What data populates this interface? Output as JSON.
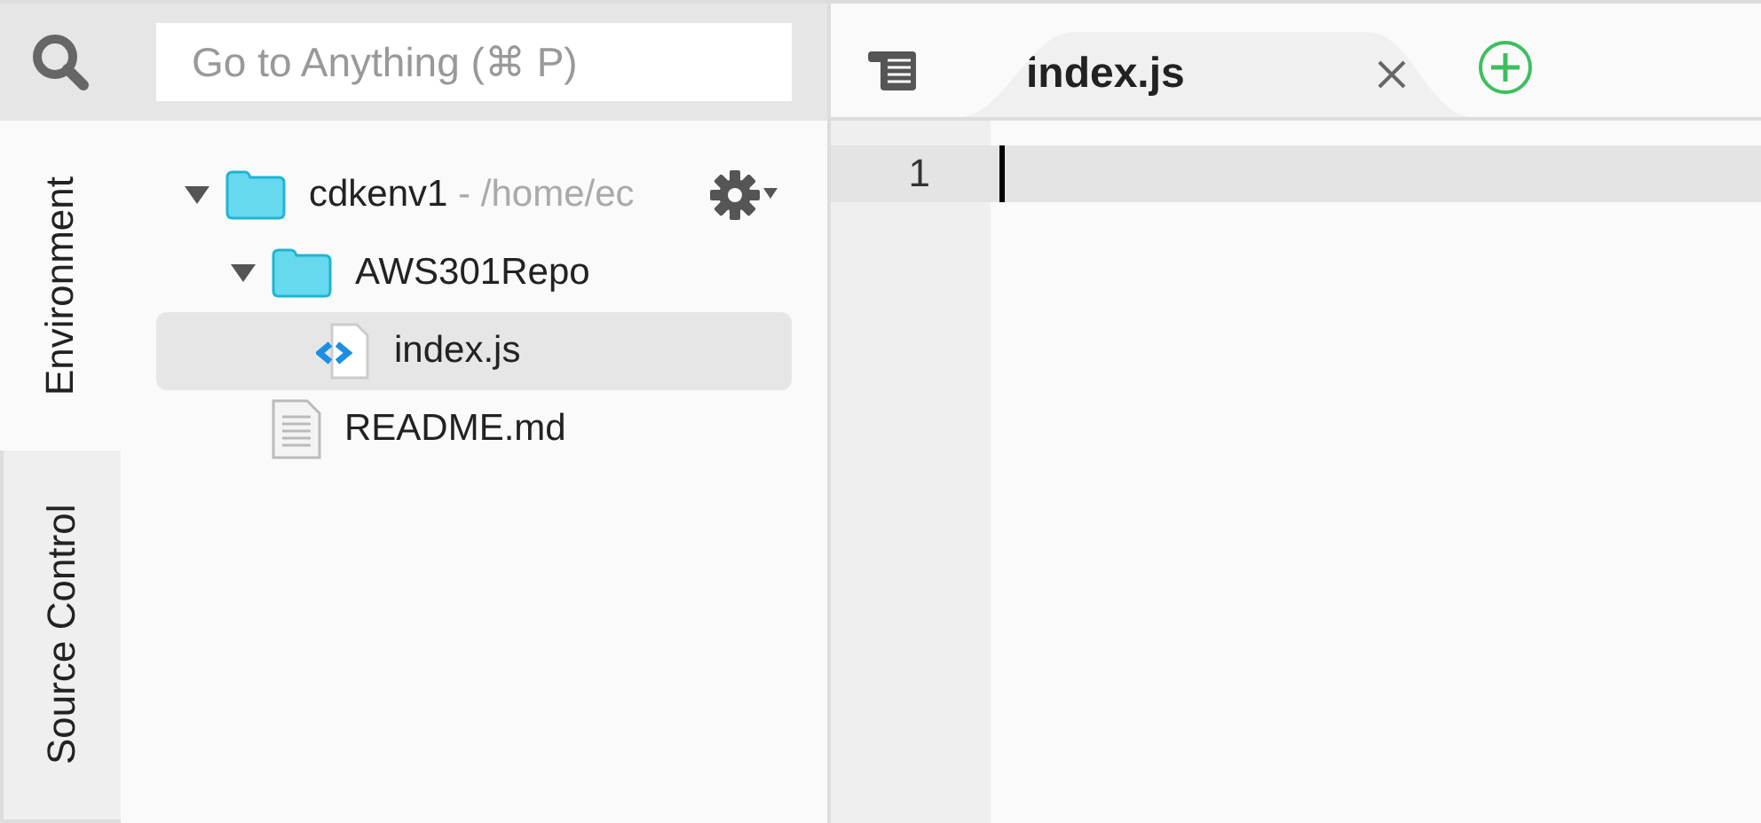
{
  "search": {
    "placeholder": "Go to Anything (⌘ P)"
  },
  "side_tabs": [
    {
      "label": "Environment",
      "selected": true
    },
    {
      "label": "Source Control",
      "selected": false
    }
  ],
  "tree": [
    {
      "name": "cdkenv1",
      "path": " - /home/ec",
      "kind": "folder",
      "expanded": true,
      "selected": false,
      "children": [
        {
          "name": "AWS301Repo",
          "kind": "folder",
          "expanded": true,
          "selected": false,
          "children": [
            {
              "name": "index.js",
              "kind": "script",
              "selected": true
            }
          ]
        },
        {
          "name": "README.md",
          "kind": "text",
          "selected": false
        }
      ]
    }
  ],
  "editor": {
    "tabs": [
      {
        "label": "index.js",
        "selected": true
      }
    ],
    "lines": [
      {
        "number": "1",
        "current": true
      }
    ]
  }
}
